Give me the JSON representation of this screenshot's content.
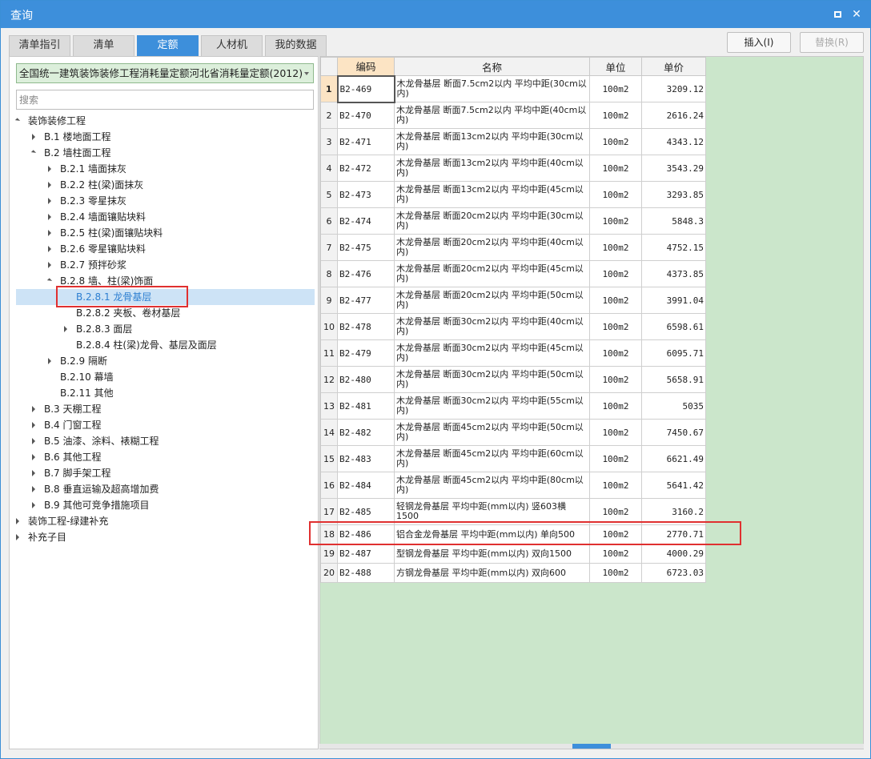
{
  "window": {
    "title": "查询",
    "maximize_label": "□",
    "close_label": "✕"
  },
  "tabs": [
    {
      "label": "清单指引",
      "active": false
    },
    {
      "label": "清单",
      "active": false
    },
    {
      "label": "定额",
      "active": true
    },
    {
      "label": "人材机",
      "active": false
    },
    {
      "label": "我的数据",
      "active": false
    }
  ],
  "buttons": {
    "insert": "插入(I)",
    "replace": "替换(R)"
  },
  "library": {
    "selected": "全国统一建筑装饰装修工程消耗量定额河北省消耗量定额(2012)"
  },
  "search": {
    "placeholder": "搜索",
    "value": ""
  },
  "tree": [
    {
      "label": "装饰装修工程",
      "level": 0,
      "toggle": "open"
    },
    {
      "label": "B.1 楼地面工程",
      "level": 1,
      "toggle": "closed"
    },
    {
      "label": "B.2 墙柱面工程",
      "level": 1,
      "toggle": "open"
    },
    {
      "label": "B.2.1 墙面抹灰",
      "level": 2,
      "toggle": "closed"
    },
    {
      "label": "B.2.2 柱(梁)面抹灰",
      "level": 2,
      "toggle": "closed"
    },
    {
      "label": "B.2.3 零星抹灰",
      "level": 2,
      "toggle": "closed"
    },
    {
      "label": "B.2.4 墙面镶贴块料",
      "level": 2,
      "toggle": "closed"
    },
    {
      "label": "B.2.5 柱(梁)面镶贴块料",
      "level": 2,
      "toggle": "closed"
    },
    {
      "label": "B.2.6 零星镶贴块料",
      "level": 2,
      "toggle": "closed"
    },
    {
      "label": "B.2.7 预拌砂浆",
      "level": 2,
      "toggle": "closed"
    },
    {
      "label": "B.2.8 墙、柱(梁)饰面",
      "level": 2,
      "toggle": "open"
    },
    {
      "label": "B.2.8.1 龙骨基层",
      "level": 3,
      "toggle": "none",
      "selected": true
    },
    {
      "label": "B.2.8.2 夹板、卷材基层",
      "level": 3,
      "toggle": "none"
    },
    {
      "label": "B.2.8.3 面层",
      "level": 3,
      "toggle": "closed"
    },
    {
      "label": "B.2.8.4 柱(梁)龙骨、基层及面层",
      "level": 3,
      "toggle": "none"
    },
    {
      "label": "B.2.9 隔断",
      "level": 2,
      "toggle": "closed"
    },
    {
      "label": "B.2.10 幕墙",
      "level": 2,
      "toggle": "none"
    },
    {
      "label": "B.2.11 其他",
      "level": 2,
      "toggle": "none"
    },
    {
      "label": "B.3 天棚工程",
      "level": 1,
      "toggle": "closed"
    },
    {
      "label": "B.4 门窗工程",
      "level": 1,
      "toggle": "closed"
    },
    {
      "label": "B.5 油漆、涂料、裱糊工程",
      "level": 1,
      "toggle": "closed"
    },
    {
      "label": "B.6 其他工程",
      "level": 1,
      "toggle": "closed"
    },
    {
      "label": "B.7 脚手架工程",
      "level": 1,
      "toggle": "closed"
    },
    {
      "label": "B.8 垂直运输及超高增加费",
      "level": 1,
      "toggle": "closed"
    },
    {
      "label": "B.9 其他可竞争措施项目",
      "level": 1,
      "toggle": "closed"
    },
    {
      "label": "装饰工程-绿建补充",
      "level": 0,
      "toggle": "closed"
    },
    {
      "label": "补充子目",
      "level": 0,
      "toggle": "closed"
    }
  ],
  "table": {
    "columns": [
      "编码",
      "名称",
      "单位",
      "单价"
    ],
    "rows": [
      {
        "no": "1",
        "code": "B2-469",
        "name": "木龙骨基层 断面7.5cm2以内 平均中距(30cm以内)",
        "unit": "100m2",
        "price": "3209.12"
      },
      {
        "no": "2",
        "code": "B2-470",
        "name": "木龙骨基层 断面7.5cm2以内 平均中距(40cm以内)",
        "unit": "100m2",
        "price": "2616.24"
      },
      {
        "no": "3",
        "code": "B2-471",
        "name": "木龙骨基层 断面13cm2以内 平均中距(30cm以内)",
        "unit": "100m2",
        "price": "4343.12"
      },
      {
        "no": "4",
        "code": "B2-472",
        "name": "木龙骨基层 断面13cm2以内 平均中距(40cm以内)",
        "unit": "100m2",
        "price": "3543.29"
      },
      {
        "no": "5",
        "code": "B2-473",
        "name": "木龙骨基层 断面13cm2以内 平均中距(45cm以内)",
        "unit": "100m2",
        "price": "3293.85"
      },
      {
        "no": "6",
        "code": "B2-474",
        "name": "木龙骨基层 断面20cm2以内 平均中距(30cm以内)",
        "unit": "100m2",
        "price": "5848.3"
      },
      {
        "no": "7",
        "code": "B2-475",
        "name": "木龙骨基层 断面20cm2以内 平均中距(40cm以内)",
        "unit": "100m2",
        "price": "4752.15"
      },
      {
        "no": "8",
        "code": "B2-476",
        "name": "木龙骨基层 断面20cm2以内 平均中距(45cm以内)",
        "unit": "100m2",
        "price": "4373.85"
      },
      {
        "no": "9",
        "code": "B2-477",
        "name": "木龙骨基层 断面20cm2以内 平均中距(50cm以内)",
        "unit": "100m2",
        "price": "3991.04"
      },
      {
        "no": "10",
        "code": "B2-478",
        "name": "木龙骨基层 断面30cm2以内 平均中距(40cm以内)",
        "unit": "100m2",
        "price": "6598.61"
      },
      {
        "no": "11",
        "code": "B2-479",
        "name": "木龙骨基层 断面30cm2以内 平均中距(45cm以内)",
        "unit": "100m2",
        "price": "6095.71"
      },
      {
        "no": "12",
        "code": "B2-480",
        "name": "木龙骨基层 断面30cm2以内 平均中距(50cm以内)",
        "unit": "100m2",
        "price": "5658.91"
      },
      {
        "no": "13",
        "code": "B2-481",
        "name": "木龙骨基层 断面30cm2以内 平均中距(55cm以内)",
        "unit": "100m2",
        "price": "5035"
      },
      {
        "no": "14",
        "code": "B2-482",
        "name": "木龙骨基层 断面45cm2以内 平均中距(50cm以内)",
        "unit": "100m2",
        "price": "7450.67"
      },
      {
        "no": "15",
        "code": "B2-483",
        "name": "木龙骨基层 断面45cm2以内 平均中距(60cm以内)",
        "unit": "100m2",
        "price": "6621.49"
      },
      {
        "no": "16",
        "code": "B2-484",
        "name": "木龙骨基层 断面45cm2以内 平均中距(80cm以内)",
        "unit": "100m2",
        "price": "5641.42"
      },
      {
        "no": "17",
        "code": "B2-485",
        "name": "轻钢龙骨基层 平均中距(mm以内) 竖603横1500",
        "unit": "100m2",
        "price": "3160.2"
      },
      {
        "no": "18",
        "code": "B2-486",
        "name": "铝合金龙骨基层 平均中距(mm以内) 单向500",
        "unit": "100m2",
        "price": "2770.71"
      },
      {
        "no": "19",
        "code": "B2-487",
        "name": "型钢龙骨基层 平均中距(mm以内) 双向1500",
        "unit": "100m2",
        "price": "4000.29"
      },
      {
        "no": "20",
        "code": "B2-488",
        "name": "方钢龙骨基层 平均中距(mm以内) 双向600",
        "unit": "100m2",
        "price": "6723.03"
      }
    ]
  }
}
